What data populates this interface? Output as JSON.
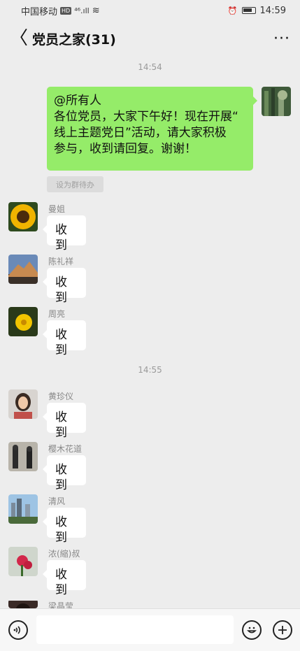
{
  "status": {
    "carrier": "中国移动",
    "hd": "HD",
    "signal": "⁴⁶.ıll",
    "wifi": "≋",
    "alarm": "⏰",
    "time": "14:59"
  },
  "header": {
    "back": "〈",
    "title": "党员之家(31)",
    "more": "···"
  },
  "timestamps": [
    "14:54",
    "14:55"
  ],
  "self_message": {
    "text_lines": [
      "@所有人",
      "各位党员，大家下午好！现在开展“",
      "线上主题党日”活动，请大家积极",
      "参与，收到请回复。谢谢！"
    ],
    "todo_label": "设为群待办"
  },
  "messages": [
    {
      "name": "曼姐",
      "text": "收到"
    },
    {
      "name": "陈礼祥",
      "text": "收到"
    },
    {
      "name": "周亮",
      "text": "收到"
    },
    {
      "name": "黄珍仪",
      "text": "收到"
    },
    {
      "name": "樱木花道",
      "text": "收到"
    },
    {
      "name": "清风",
      "text": "收到"
    },
    {
      "name": "浓(縮)叔",
      "text": "收到"
    },
    {
      "name": "梁晶莹",
      "text": ""
    }
  ],
  "colors": {
    "self_bubble": "#95ec69",
    "background": "#ededed"
  }
}
